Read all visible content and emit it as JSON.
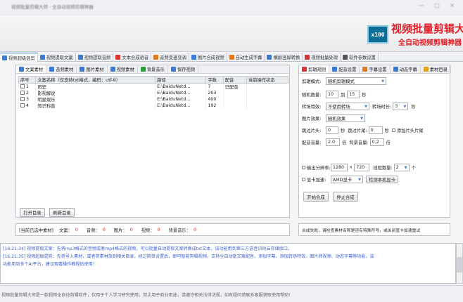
{
  "window": {
    "title": "视频批量剪辑大师 · 全自动视频剪辑神器",
    "controls": "— □ ×"
  },
  "logo": {
    "badge": "x100",
    "title": "视频批量剪辑大师",
    "subtitle": "全自动视频剪辑神器"
  },
  "main_tabs": [
    {
      "label": "视频超级混剪",
      "icon": "scissors-icon",
      "color": "#3a7bd5"
    },
    {
      "label": "视频提取文案",
      "icon": "document-icon",
      "color": "#3a7bd5"
    },
    {
      "label": "视频提取音频",
      "icon": "audio-icon",
      "color": "#3a7bd5"
    },
    {
      "label": "文本合成语音",
      "icon": "microphone-icon",
      "color": "#d33"
    },
    {
      "label": "音频变速变调",
      "icon": "tempo-icon",
      "color": "#e07a1f"
    },
    {
      "label": "图片合成视频",
      "icon": "image-icon",
      "color": "#3a7bd5"
    },
    {
      "label": "自动生成字幕",
      "icon": "subtitle-icon",
      "color": "#e07a1f"
    },
    {
      "label": "横屏竖屏转换",
      "icon": "rotate-icon",
      "color": "#3a7bd5"
    },
    {
      "label": "视频批量处理",
      "icon": "film-icon",
      "color": "#d33"
    },
    {
      "label": "软件参数设置",
      "icon": "gear-icon",
      "color": "#555"
    }
  ],
  "material_tabs": [
    {
      "label": "文案素材",
      "icon": "doc-icon",
      "color": "#3a7bd5"
    },
    {
      "label": "音频素材",
      "icon": "music-icon",
      "color": "#3a7bd5"
    },
    {
      "label": "图片素材",
      "icon": "picture-icon",
      "color": "#3a7bd5"
    },
    {
      "label": "视频素材",
      "icon": "video-icon",
      "color": "#3a7bd5"
    },
    {
      "label": "背景音乐",
      "icon": "note-icon",
      "color": "#2a9d3a"
    },
    {
      "label": "保存视频",
      "icon": "save-icon",
      "color": "#3a7bd5"
    }
  ],
  "material_table": {
    "columns": [
      "序号",
      "文案名称（仅支持txt格式，编码：utf-8）",
      "路径",
      "字数",
      "配音",
      "当前操作状态"
    ],
    "rows": [
      [
        "1",
        "历史",
        "E:\\BaiduNetd...",
        "7",
        "已配音",
        ""
      ],
      [
        "2",
        "影视解说",
        "E:\\BaiduNetd...",
        "203",
        "",
        ""
      ],
      [
        "3",
        "明星娱乐",
        "E:\\BaiduNetd...",
        "400",
        "",
        ""
      ],
      [
        "4",
        "知识科普",
        "E:\\BaiduNetd...",
        "192",
        "",
        ""
      ]
    ]
  },
  "buttons": {
    "open_dir": "打开目录",
    "refresh_dir": "刷新目录"
  },
  "counts": {
    "label": "[当前已选中素材]",
    "items": [
      {
        "label": "文案：",
        "value": "0"
      },
      {
        "label": "音频：",
        "value": "0"
      },
      {
        "label": "图片：",
        "value": "0"
      },
      {
        "label": "视频：",
        "value": "0"
      },
      {
        "label": "背景音乐：",
        "value": "0"
      }
    ]
  },
  "settings_tabs": [
    {
      "label": "剪辑规则",
      "icon": "rule-icon",
      "color": "#d33"
    },
    {
      "label": "配音设置",
      "icon": "voice-icon",
      "color": "#3a7bd5"
    },
    {
      "label": "字幕设置",
      "icon": "caption-icon",
      "color": "#e07a1f"
    },
    {
      "label": "动态字幕",
      "icon": "anim-icon",
      "color": "#3a7bd5"
    },
    {
      "label": "素材目录",
      "icon": "folder-icon",
      "color": "#e0a21f"
    }
  ],
  "settings": {
    "mode_label": "剪辑模式:",
    "mode_value": "随机剪辑模式",
    "random_label": "随机数量:",
    "random_min": "10",
    "random_to": "到",
    "random_max": "15",
    "random_unit": "秒",
    "effect_label": "转场特效:",
    "effect_value": "不使用转场",
    "effect_duration_label": "转场时长:",
    "effect_duration": "3",
    "effect_unit": "秒",
    "image_effect_label": "图片效果:",
    "image_effect_value": "随机效果",
    "head_label": "跳过片头:",
    "head_value": "0",
    "head_unit": "秒",
    "tail_label": "跳过片尾:",
    "tail_value": "0",
    "tail_unit": "秒",
    "add_head_tail": "添加片头片尾",
    "voice_vol_label": "配音音量:",
    "voice_vol": "2.0",
    "voice_vol_unit": "倍",
    "bgm_vol_label": "背景音量:",
    "bgm_vol": "0.2",
    "bgm_vol_unit": "倍",
    "res_label": "输出分辨率:",
    "res_w": "1280",
    "res_x": "×",
    "res_h": "720",
    "threads_label": "线程数量:",
    "threads": "2",
    "threads_unit": "个",
    "gpu_label": "显卡加速:",
    "gpu_value": "AMD显卡",
    "detect_gpu": "检测本机显卡",
    "start": "开始合成",
    "stop": "停止合成"
  },
  "error_msg": "合成失败，请检查素材名称是否有特殊符号，或关闭显卡加速重试",
  "log": [
    "[16:21:34] 视频提取文案：先将mp3格式的音频或者mp4格式的视频，可以批量自动提取文案转换成txt文本，该功能用到第三方语音识别云存储接口。",
    "[16:21:35] 视频超级混剪：先将导入素材，或者将素材放到相关目录，经过简单设置后，即可智能剪辑视频，支持全自动批文案配音、添加字幕、添加转场特效、图片转视频、动态字幕等功能，该",
    "功能用到多个AI平台，建议观看操作教程后使用！"
  ],
  "footer": "视频批量剪辑大师是一款视频全自动剪辑软件，仅用于个人学习研究使用，禁止用于商业用途，请遵守相关法律法规，如有疑问请联系客服获取使用帮助！"
}
